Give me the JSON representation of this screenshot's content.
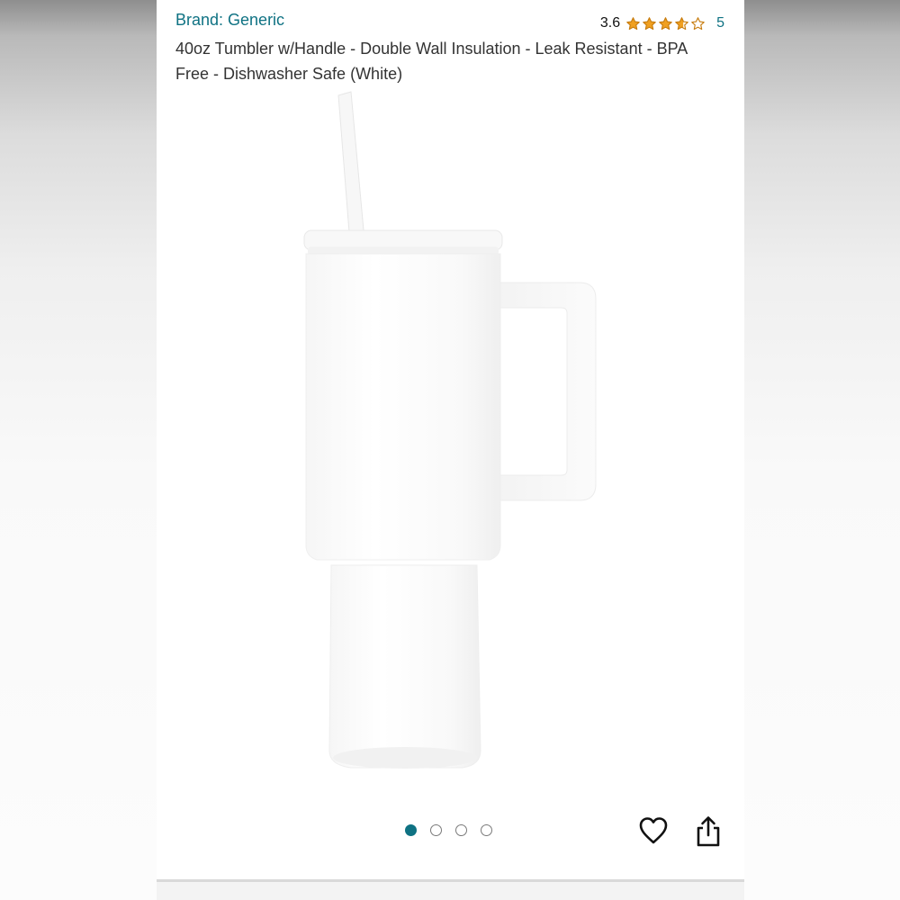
{
  "product": {
    "brand": "Brand: Generic",
    "rating_value": "3.6",
    "rating_stars": 3.6,
    "review_count": "5",
    "title": "40oz Tumbler w/Handle - Double Wall Insulation - Leak Resistant - BPA Free - Dishwasher Safe (White)"
  },
  "gallery": {
    "image_count": 4,
    "active_index": 0
  },
  "icons": {
    "star": "star-icon",
    "wishlist": "heart-icon",
    "share": "share-icon"
  },
  "colors": {
    "link": "#0f7283",
    "star": "#f0a020",
    "text": "#333333"
  }
}
